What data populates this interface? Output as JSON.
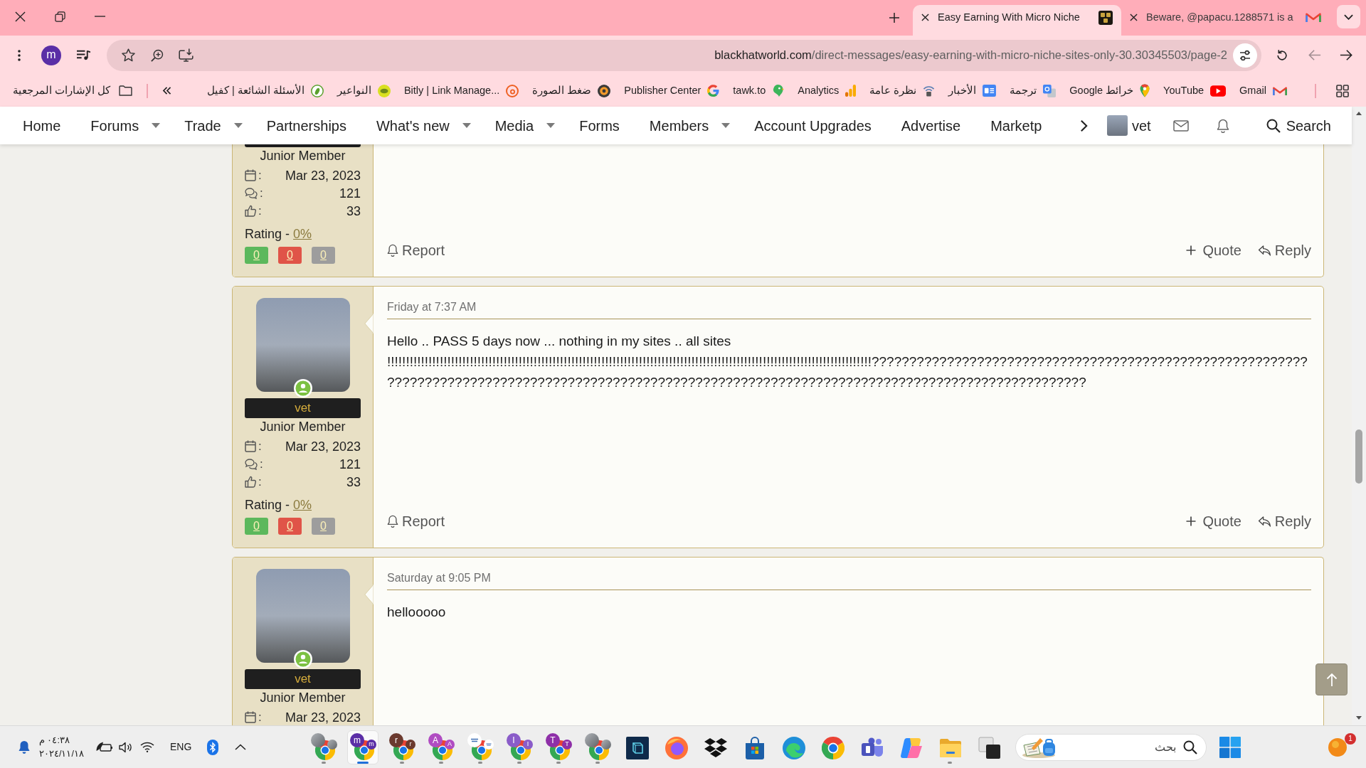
{
  "tab_strip": {
    "tabs": [
      {
        "title": "Easy Earning With Micro Niche",
        "kind": "tile",
        "selected": true
      },
      {
        "title": "Beware, @papacu.1288571 is a",
        "kind": "mail",
        "selected": false
      }
    ]
  },
  "toolbar": {
    "profile_letter": "m",
    "url_host": "blackhatworld.com",
    "url_path": "/direct-messages/easy-earning-with-micro-niche-sites-only-30.30345503/page-2",
    "history_buttons": [
      {
        "kind": "forward",
        "disabled": true
      },
      {
        "kind": "back",
        "disabled": false
      }
    ]
  },
  "bookmarks_bar": {
    "all_bookmarks": {
      "label": "كل الإشارات المرجعية"
    },
    "bookmarks": [
      {
        "label": "الأسئلة الشائعة | كفيل",
        "kind": "leaf"
      },
      {
        "label": "النواعير",
        "kind": "round"
      },
      {
        "label": "Bitly | Link Manage...",
        "kind": "ring"
      },
      {
        "label": "ضغط الصورة",
        "kind": "badge"
      },
      {
        "label": "Publisher Center",
        "kind": "gring"
      },
      {
        "label": "tawk.to",
        "kind": "bird"
      },
      {
        "label": "Analytics",
        "kind": "bars"
      },
      {
        "label": "نظرة عامة",
        "kind": "lock"
      },
      {
        "label": "الأخبار",
        "kind": "news"
      },
      {
        "label": "ترجمة",
        "kind": "translate"
      },
      {
        "label": "خرائط Google",
        "kind": "pin"
      },
      {
        "label": "YouTube",
        "kind": "play"
      },
      {
        "label": "Gmail",
        "kind": "mail"
      }
    ]
  },
  "site_nav": {
    "items": [
      {
        "label": "Home",
        "has_menu": false
      },
      {
        "label": "Forums",
        "has_menu": true
      },
      {
        "label": "Trade",
        "has_menu": true
      },
      {
        "label": "Partnerships",
        "has_menu": false
      },
      {
        "label": "What's new",
        "has_menu": true
      },
      {
        "label": "Media",
        "has_menu": true
      },
      {
        "label": "Forms",
        "has_menu": false
      },
      {
        "label": "Members",
        "has_menu": true
      },
      {
        "label": "Account Upgrades",
        "has_menu": false
      },
      {
        "label": "Advertise",
        "has_menu": false
      },
      {
        "label": "Marketp",
        "has_menu": false
      }
    ],
    "user_name": "vet",
    "search_label": "Search"
  },
  "posts": [
    {
      "top_clipped": true,
      "rank": "Junior Member",
      "stats": [
        {
          "kind": "joined",
          "separator": ":",
          "value": "Mar 23, 2023"
        },
        {
          "kind": "messages",
          "separator": ":",
          "value": "121"
        },
        {
          "kind": "likes",
          "separator": ":",
          "value": "33"
        }
      ],
      "rating": {
        "label": "Rating -",
        "value": "0%"
      },
      "votes": [
        {
          "kind": "positive",
          "value": "0"
        },
        {
          "kind": "negative",
          "value": "0"
        },
        {
          "kind": "neutral",
          "value": "0"
        }
      ],
      "actions": [
        {
          "kind": "report",
          "label": "Report"
        },
        {
          "kind": "quote",
          "label": "Quote"
        },
        {
          "kind": "reply",
          "label": "Reply"
        }
      ]
    },
    {
      "top_clipped": false,
      "online": true,
      "username": "vet",
      "rank": "Junior Member",
      "stats": [
        {
          "kind": "joined",
          "separator": ":",
          "value": "Mar 23, 2023"
        },
        {
          "kind": "messages",
          "separator": ":",
          "value": "121"
        },
        {
          "kind": "likes",
          "separator": ":",
          "value": "33"
        }
      ],
      "rating": {
        "label": "Rating -",
        "value": "0%"
      },
      "votes": [
        {
          "kind": "positive",
          "value": "0"
        },
        {
          "kind": "negative",
          "value": "0"
        },
        {
          "kind": "neutral",
          "value": "0"
        }
      ],
      "date": "Friday at 7:37 AM",
      "message": "Hello .. PASS 5 days now ... nothing in my sites .. all sites !!!!!!!!!!!!!!!!!!!!!!!!!!!!!!!!!!!!!!!!!!!!!!!!!!!!!!!!!!!!!!!!!!!!!!!!!!!!!!!!!!!!!!!!!!!!!!!!!!!!!!!!!!!!!!!!!!!!!!!!!!!!!!!!!???????????????????????????????????????????????????????????????????????????????????????????????????????????????????????????????????????????????????????",
      "actions": [
        {
          "kind": "report",
          "label": "Report"
        },
        {
          "kind": "quote",
          "label": "Quote"
        },
        {
          "kind": "reply",
          "label": "Reply"
        }
      ]
    },
    {
      "top_clipped": false,
      "online": true,
      "username": "vet",
      "rank": "Junior Member",
      "stats": [
        {
          "kind": "joined",
          "separator": ":",
          "value": "Mar 23, 2023"
        }
      ],
      "date": "Saturday at 9:05 PM",
      "message": "hellooooo"
    }
  ],
  "taskbar": {
    "time": "٠٤:٣٨ م",
    "date": "٢٠٢٤/١١/١٨",
    "language": "ENG",
    "apps": [
      {
        "kind": "profile",
        "avatars": [
          {
            "kind": "photo"
          },
          {
            "kind": "photo"
          }
        ],
        "running": true,
        "active": false
      },
      {
        "kind": "profile",
        "avatars": [
          {
            "kind": "letter",
            "letter": "m",
            "color": "#5b2ea6"
          },
          {
            "kind": "letter",
            "letter": "m",
            "color": "#5b2ea6"
          }
        ],
        "running": true,
        "active": true
      },
      {
        "kind": "profile",
        "avatars": [
          {
            "kind": "letter",
            "letter": "r",
            "color": "#6b3a2e"
          },
          {
            "kind": "letter",
            "letter": "r",
            "color": "#6b3a2e"
          }
        ],
        "running": true,
        "active": false
      },
      {
        "kind": "profile",
        "avatars": [
          {
            "kind": "letter",
            "letter": "A",
            "color": "#b04cc2"
          },
          {
            "kind": "letter",
            "letter": "A",
            "color": "#b04cc2"
          }
        ],
        "running": true,
        "active": false
      },
      {
        "kind": "profile",
        "avatars": [
          {
            "kind": "logo"
          },
          {
            "kind": "logo"
          }
        ],
        "running": true,
        "active": false
      },
      {
        "kind": "profile",
        "avatars": [
          {
            "kind": "letter",
            "letter": "I",
            "color": "#8a5cc9"
          },
          {
            "kind": "letter",
            "letter": "I",
            "color": "#8a5cc9"
          }
        ],
        "running": true,
        "active": false
      },
      {
        "kind": "profile",
        "avatars": [
          {
            "kind": "letter",
            "letter": "T",
            "color": "#8e2fa8"
          },
          {
            "kind": "letter",
            "letter": "T",
            "color": "#8e2fa8"
          }
        ],
        "running": true,
        "active": false
      },
      {
        "kind": "profile",
        "avatars": [
          {
            "kind": "photo"
          },
          {
            "kind": "photo"
          }
        ],
        "running": true,
        "active": false
      },
      {
        "kind": "cube",
        "running": false,
        "active": false
      },
      {
        "kind": "flame",
        "running": false,
        "active": false
      },
      {
        "kind": "diamonds",
        "running": false,
        "active": false
      },
      {
        "kind": "bag",
        "running": false,
        "active": false
      },
      {
        "kind": "swirl",
        "running": false,
        "active": false
      },
      {
        "kind": "browser",
        "running": false,
        "active": false
      },
      {
        "kind": "people",
        "running": false,
        "active": false
      },
      {
        "kind": "ribbon",
        "running": false,
        "active": false
      },
      {
        "kind": "folder",
        "running": true,
        "active": false
      },
      {
        "kind": "squares",
        "running": false,
        "active": false
      }
    ],
    "search_placeholder": "بحث",
    "badge_count": "1"
  }
}
